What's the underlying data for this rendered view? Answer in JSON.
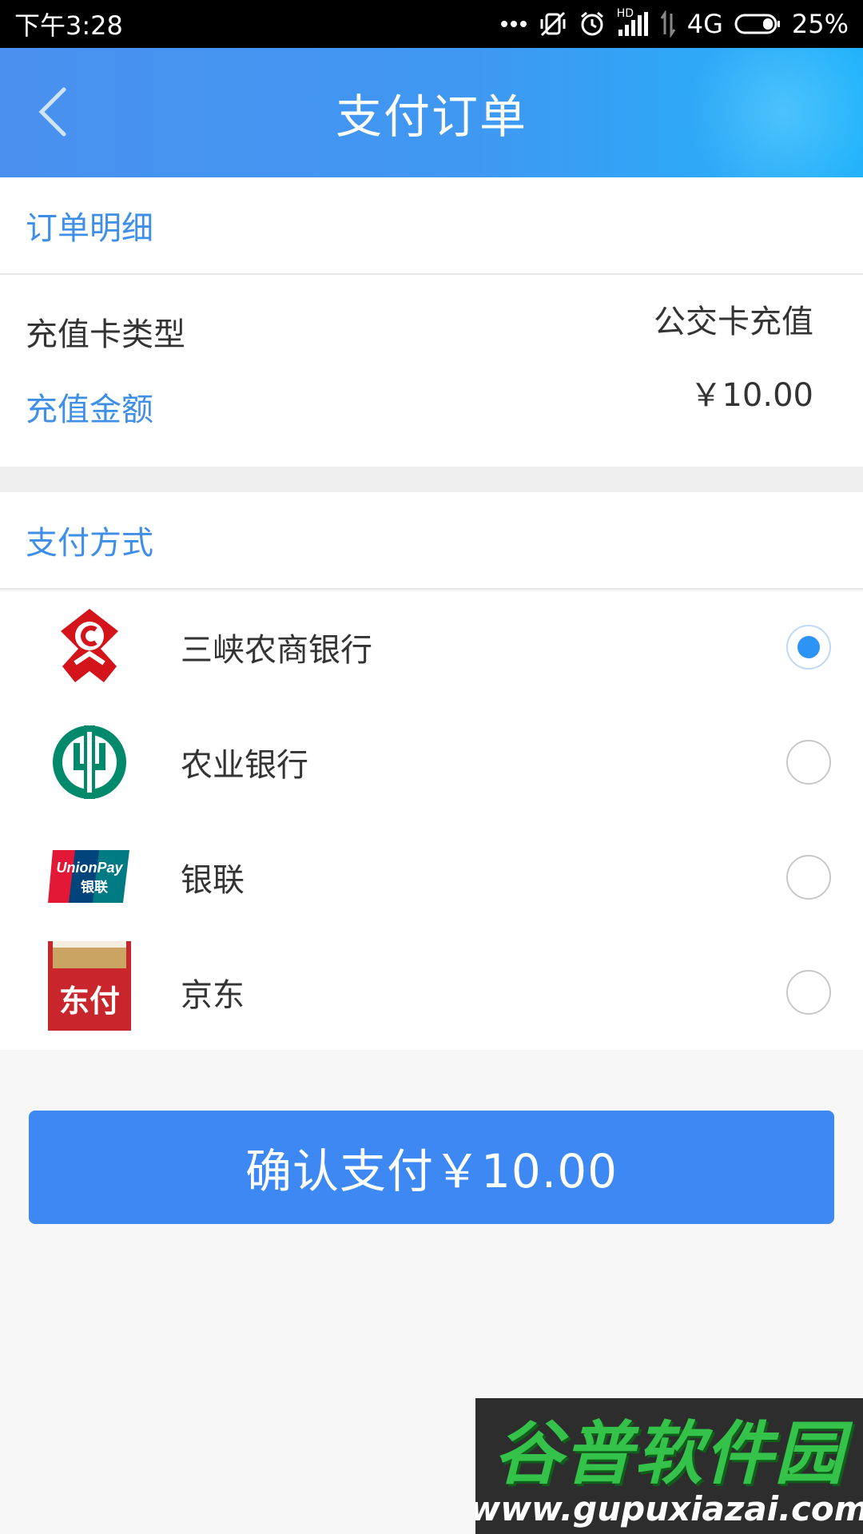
{
  "status_bar": {
    "time": "下午3:28",
    "network": "4G",
    "hd_badge": "HD",
    "battery": "25%",
    "icons": [
      "more-dots-icon",
      "mute-vibrate-icon",
      "alarm-icon",
      "signal-icon",
      "data-arrows-icon",
      "battery-icon"
    ]
  },
  "header": {
    "title": "支付订单",
    "back_icon": "chevron-left-icon"
  },
  "order_detail": {
    "heading": "订单明细",
    "rows": [
      {
        "label": "充值卡类型",
        "value": "公交卡充值"
      },
      {
        "label": "充值金额",
        "value": "￥10.00"
      }
    ]
  },
  "payment": {
    "heading": "支付方式",
    "methods": [
      {
        "label": "三峡农商银行",
        "icon": "rural-commercial-bank-logo",
        "selected": true
      },
      {
        "label": "农业银行",
        "icon": "agricultural-bank-logo",
        "selected": false
      },
      {
        "label": "银联",
        "icon": "unionpay-logo",
        "selected": false
      },
      {
        "label": "京东",
        "icon": "jd-pay-logo",
        "selected": false
      }
    ],
    "unionpay_logo_text": {
      "line1": "UnionPay",
      "line2": "银联"
    },
    "jd_logo_text": "东付"
  },
  "confirm_button": {
    "label": "确认支付￥10.00"
  },
  "watermark": {
    "title": "谷普软件园",
    "url": "www.gupuxiazai.com"
  },
  "colors": {
    "accent": "#3d88f2",
    "section_heading": "#3f8fe8",
    "radio_selected": "#2d93f5"
  }
}
